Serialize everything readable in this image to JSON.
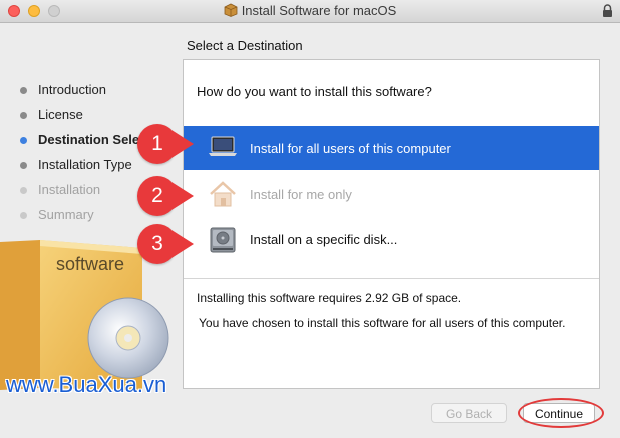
{
  "window": {
    "title": "Install Software for macOS"
  },
  "section_title": "Select a Destination",
  "steps": [
    {
      "label": "Introduction",
      "state": "done"
    },
    {
      "label": "License",
      "state": "done"
    },
    {
      "label": "Destination Select",
      "state": "active"
    },
    {
      "label": "Installation Type",
      "state": "done"
    },
    {
      "label": "Installation",
      "state": "disabled"
    },
    {
      "label": "Summary",
      "state": "disabled"
    }
  ],
  "software_box_label": "software",
  "panel": {
    "question": "How do you want to install this software?",
    "options": [
      {
        "label": "Install for all users of this computer",
        "icon": "laptop-icon",
        "selected": true
      },
      {
        "label": "Install for me only",
        "icon": "home-icon",
        "disabled": true
      },
      {
        "label": "Install on a specific disk...",
        "icon": "disk-icon"
      }
    ],
    "requirement": "Installing this software requires 2.92 GB of space.",
    "chosen": "You have chosen to install this software for all users of this computer."
  },
  "annotations": [
    "1",
    "2",
    "3"
  ],
  "buttons": {
    "back": "Go Back",
    "continue": "Continue"
  },
  "watermark": "www.BuaXua.vn",
  "colors": {
    "selection": "#2469d6",
    "badge": "#e8393b",
    "watermark": "#1a5ed3"
  }
}
